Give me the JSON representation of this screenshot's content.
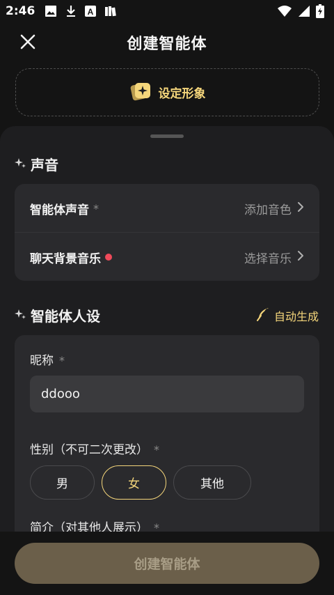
{
  "status_bar": {
    "time": "2:46",
    "icons": [
      "image-icon",
      "download-icon",
      "a-icon",
      "books-icon"
    ],
    "right_icons": [
      "wifi-icon",
      "signal-icon",
      "battery-icon"
    ]
  },
  "header": {
    "title": "创建智能体",
    "close_icon": "close-icon"
  },
  "avatar_setup": {
    "label": "设定形象",
    "icon": "sparkle-card-icon"
  },
  "voice_section": {
    "title": "声音",
    "rows": [
      {
        "label": "智能体声音",
        "required": "*",
        "value": "添加音色"
      },
      {
        "label": "聊天背景音乐",
        "value": "选择音乐"
      }
    ]
  },
  "persona_section": {
    "title": "智能体人设",
    "auto_generate": "自动生成",
    "nickname_label": "昵称",
    "nickname_required": "*",
    "nickname_value": "ddooo",
    "gender_label": "性别（不可二次更改）",
    "gender_required": "*",
    "gender_options": [
      "男",
      "女",
      "其他"
    ],
    "gender_selected": "女",
    "intro_label": "简介（对其他人展示）",
    "intro_required": "*"
  },
  "footer": {
    "create_button": "创建智能体"
  },
  "colors": {
    "accent": "#f5d67b",
    "background": "#141414",
    "sheet": "#1e1e20",
    "card": "#2a2a2d",
    "red_dot": "#ef4a5a",
    "button_disabled": "#6b5f4a"
  }
}
